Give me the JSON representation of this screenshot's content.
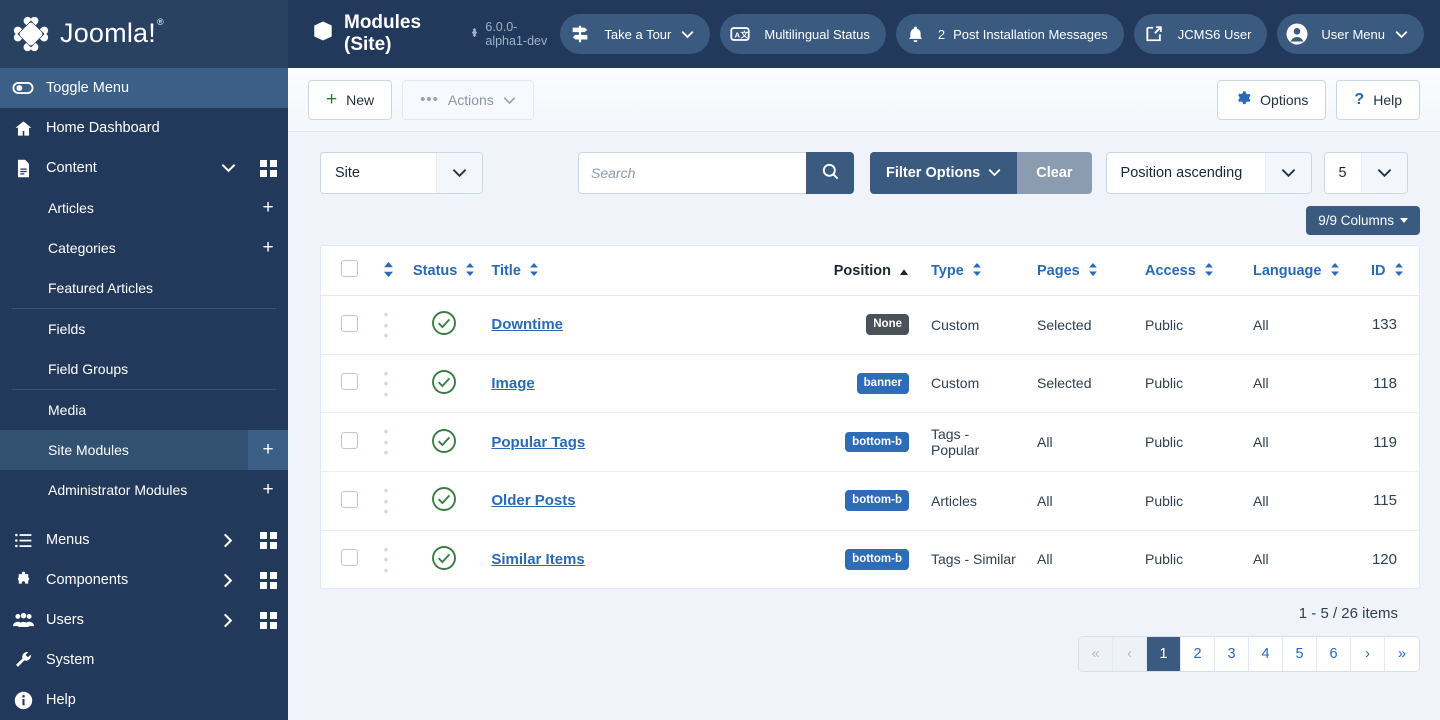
{
  "brand": {
    "name": "Joomla!",
    "trademark": "®"
  },
  "sidebar": {
    "toggle_label": "Toggle Menu",
    "items": [
      {
        "label": "Home Dashboard",
        "icon": "home-icon"
      },
      {
        "label": "Content",
        "icon": "document-icon"
      }
    ],
    "content_children": [
      {
        "label": "Articles",
        "plus": "+"
      },
      {
        "label": "Categories",
        "plus": "+"
      },
      {
        "label": "Featured Articles",
        "plus": ""
      },
      {
        "label": "Fields",
        "plus": ""
      },
      {
        "label": "Field Groups",
        "plus": ""
      },
      {
        "label": "Media",
        "plus": ""
      },
      {
        "label": "Site Modules",
        "plus": "+"
      },
      {
        "label": "Administrator Modules",
        "plus": "+"
      }
    ],
    "bottom_items": [
      {
        "label": "Menus",
        "icon": "list-icon"
      },
      {
        "label": "Components",
        "icon": "puzzle-icon"
      },
      {
        "label": "Users",
        "icon": "users-icon"
      },
      {
        "label": "System",
        "icon": "wrench-icon"
      },
      {
        "label": "Help",
        "icon": "info-icon"
      }
    ]
  },
  "header": {
    "title": "Modules (Site)",
    "title_icon": "cube-icon",
    "version": "6.0.0-alpha1-dev",
    "version_icon": "joomla-mark-icon",
    "pills": [
      {
        "label": "Take a Tour",
        "icon": "signpost-icon",
        "caret": "∨"
      },
      {
        "label": "Multilingual Status",
        "icon": "translate-icon"
      },
      {
        "label": "Post Installation Messages",
        "icon": "bell-icon",
        "count": "2"
      },
      {
        "label": "JCMS6 User",
        "icon": "external-link-icon"
      },
      {
        "label": "User Menu",
        "icon": "user-circle-icon",
        "caret": "∨"
      }
    ]
  },
  "toolbar": {
    "new_label": "New",
    "actions_label": "Actions",
    "options_label": "Options",
    "help_label": "Help"
  },
  "filters": {
    "client_selected": "Site",
    "search_placeholder": "Search",
    "search_value": "",
    "filter_options_label": "Filter Options",
    "clear_label": "Clear",
    "ordering_selected": "Position ascending",
    "limit_selected": "5",
    "columns_label": "9/9 Columns"
  },
  "table": {
    "headers": {
      "drag": "",
      "status": "Status",
      "title": "Title",
      "position": "Position",
      "type": "Type",
      "pages": "Pages",
      "access": "Access",
      "language": "Language",
      "id": "ID"
    },
    "sorted_column": "Position",
    "sort_direction": "ascending",
    "rows": [
      {
        "status": "published",
        "title": "Downtime",
        "position": "None",
        "position_style": "none",
        "type": "Custom",
        "pages": "Selected",
        "access": "Public",
        "language": "All",
        "id": "133"
      },
      {
        "status": "published",
        "title": "Image",
        "position": "banner",
        "position_style": "blue",
        "type": "Custom",
        "pages": "Selected",
        "access": "Public",
        "language": "All",
        "id": "118"
      },
      {
        "status": "published",
        "title": "Popular Tags",
        "position": "bottom-b",
        "position_style": "blue",
        "type": "Tags - Popular",
        "pages": "All",
        "access": "Public",
        "language": "All",
        "id": "119"
      },
      {
        "status": "published",
        "title": "Older Posts",
        "position": "bottom-b",
        "position_style": "blue",
        "type": "Articles",
        "pages": "All",
        "access": "Public",
        "language": "All",
        "id": "115"
      },
      {
        "status": "published",
        "title": "Similar Items",
        "position": "bottom-b",
        "position_style": "blue",
        "type": "Tags - Similar",
        "pages": "All",
        "access": "Public",
        "language": "All",
        "id": "120"
      }
    ]
  },
  "pagination": {
    "counter": "1 - 5 / 26 items",
    "first_label": "«",
    "prev_label": "‹",
    "pages": [
      "1",
      "2",
      "3",
      "4",
      "5",
      "6"
    ],
    "active_page": "1",
    "next_label": "›",
    "last_label": "»"
  },
  "colors": {
    "sidebar_bg": "#1c3d5f",
    "sidebar_item_bg": "#23395b",
    "header_bg": "#23395b",
    "accent_blue": "#2a6ab5",
    "button_blue": "#3a5a80",
    "status_green": "#3a7d44",
    "badge_dark": "#4a5159",
    "badge_blue": "#2e6cb8",
    "page_bg": "#f0f4fa"
  }
}
